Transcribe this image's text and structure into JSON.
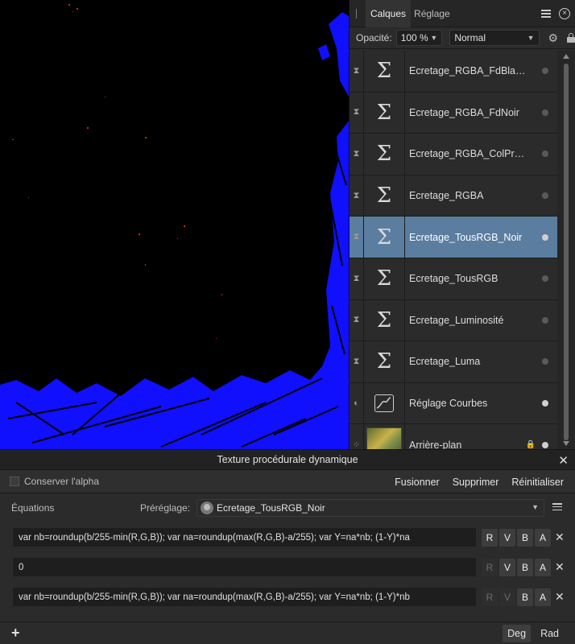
{
  "layers_panel": {
    "tabs": [
      "Calques",
      "Réglage"
    ],
    "opacity_label": "Opacité:",
    "opacity_value": "100 %",
    "blend_mode": "Normal",
    "layers": [
      {
        "name": "Ecretage_RGBA_FdBla…",
        "type": "sigma",
        "selected": false,
        "visible": false
      },
      {
        "name": "Ecretage_RGBA_FdNoir",
        "type": "sigma",
        "selected": false,
        "visible": false
      },
      {
        "name": "Ecretage_RGBA_ColPr…",
        "type": "sigma",
        "selected": false,
        "visible": false
      },
      {
        "name": "Ecretage_RGBA",
        "type": "sigma",
        "selected": false,
        "visible": false
      },
      {
        "name": "Ecretage_TousRGB_Noir",
        "type": "sigma",
        "selected": true,
        "visible": true
      },
      {
        "name": "Ecretage_TousRGB",
        "type": "sigma",
        "selected": false,
        "visible": false
      },
      {
        "name": "Ecretage_Luminosité",
        "type": "sigma",
        "selected": false,
        "visible": false
      },
      {
        "name": "Ecretage_Luma",
        "type": "sigma",
        "selected": false,
        "visible": false
      },
      {
        "name": "Réglage Courbes",
        "type": "curves",
        "selected": false,
        "visible": true
      },
      {
        "name": "Arrière-plan",
        "type": "pixel",
        "selected": false,
        "visible": true
      }
    ]
  },
  "texture_panel": {
    "title": "Texture procédurale dynamique",
    "preserve_alpha_label": "Conserver l'alpha",
    "buttons": {
      "merge": "Fusionner",
      "delete": "Supprimer",
      "reset": "Réinitialiser"
    },
    "equations_label": "Équations",
    "preset_label": "Préréglage:",
    "preset_value": "Ecretage_TousRGB_Noir",
    "equations": [
      {
        "value": "var nb=roundup(b/255-min(R,G,B)); var na=roundup(max(R,G,B)-a/255); var Y=na*nb; (1-Y)*na",
        "channels": {
          "R": true,
          "V": true,
          "B": true,
          "A": true
        }
      },
      {
        "value": "0",
        "channels": {
          "R": false,
          "V": true,
          "B": true,
          "A": true
        }
      },
      {
        "value": "var nb=roundup(b/255-min(R,G,B)); var na=roundup(max(R,G,B)-a/255); var Y=na*nb; (1-Y)*nb",
        "channels": {
          "R": false,
          "V": false,
          "B": true,
          "A": true
        }
      }
    ],
    "channel_labels": [
      "R",
      "V",
      "B",
      "A"
    ],
    "add_label": "+",
    "units": {
      "deg": "Deg",
      "rad": "Rad",
      "active": "Deg"
    }
  },
  "colors": {
    "selection": "#5a7da0",
    "canvas_fill": "#0000ff",
    "panel_bg": "#2b2b2b"
  }
}
